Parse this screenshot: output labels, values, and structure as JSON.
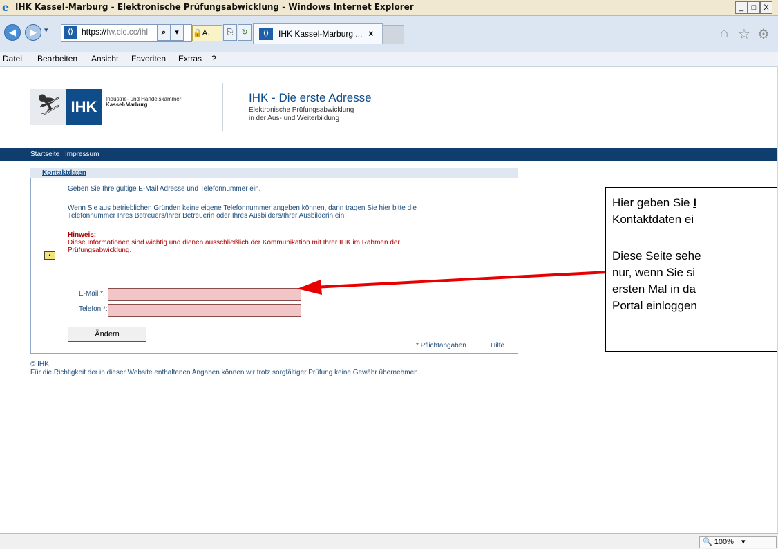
{
  "window": {
    "title": "IHK Kassel-Marburg - Elektronische Prüfungsabwicklung - Windows Internet Explorer",
    "minimize": "_",
    "maximize": "□",
    "close": "X"
  },
  "navbar": {
    "url_prefix": "https://",
    "url_rest": "fw.cic.cc/ihl",
    "lock_label": "A.",
    "tab_title": "IHK Kassel-Marburg ...",
    "tab_close": "×",
    "favicon_text": "⟨⟩"
  },
  "menu": {
    "items": [
      "Datei",
      "Bearbeiten",
      "Ansicht",
      "Favoriten",
      "Extras",
      "?"
    ]
  },
  "header": {
    "logo_text": "IHK",
    "org_line1": "Industrie- und Handelskammer",
    "org_line2": "Kassel-Marburg",
    "title": "IHK - Die erste Adresse",
    "subtitle1": "Elektronische Prüfungsabwicklung",
    "subtitle2": "in der Aus- und Weiterbildung"
  },
  "sitenav": {
    "items": [
      "Startseite",
      "Impressum"
    ]
  },
  "form": {
    "section_title": "Kontaktdaten",
    "intro": "Geben Sie Ihre gültige E-Mail Adresse und Telefonnummer ein.",
    "para1_line1": "Wenn Sie aus betrieblichen Gründen keine eigene Telefonnummer angeben können, dann tragen Sie hier bitte die",
    "para1_line2": "Telefonnummer Ihres Betreuers/Ihrer Betreuerin oder Ihres Ausbilders/Ihrer Ausbilderin ein.",
    "note_title": "Hinweis:",
    "note_line1": "Diese Informationen sind wichtig und dienen ausschließlich der Kommunikation mit Ihrer IHK im Rahmen der",
    "note_line2": "Prüfungsabwicklung.",
    "email_label": "E-Mail *:",
    "email_value": "",
    "phone_label": "Telefon *:",
    "phone_value": "",
    "submit_label": "Ändern",
    "required_note": "* Pflichtangaben",
    "help_link": "Hilfe"
  },
  "footer": {
    "copyright": "© IHK",
    "disclaimer": "Für die Richtigkeit der in dieser Website enthaltenen Angaben können wir trotz sorgfältiger Prüfung keine Gewähr übernehmen."
  },
  "callout": {
    "line1_prefix": "Hier geben Sie ",
    "line1_bold": "I",
    "line2": "Kontaktdaten ei",
    "line3": "Diese Seite sehe",
    "line4": "nur, wenn Sie si",
    "line5": "ersten Mal in da",
    "line6": "Portal einloggen"
  },
  "statusbar": {
    "zoom": "100%"
  },
  "colors": {
    "brand_blue": "#0e4c8a",
    "nav_dark": "#0e3d6e",
    "required_field": "#f2c6c6",
    "arrow_red": "#e80000"
  }
}
